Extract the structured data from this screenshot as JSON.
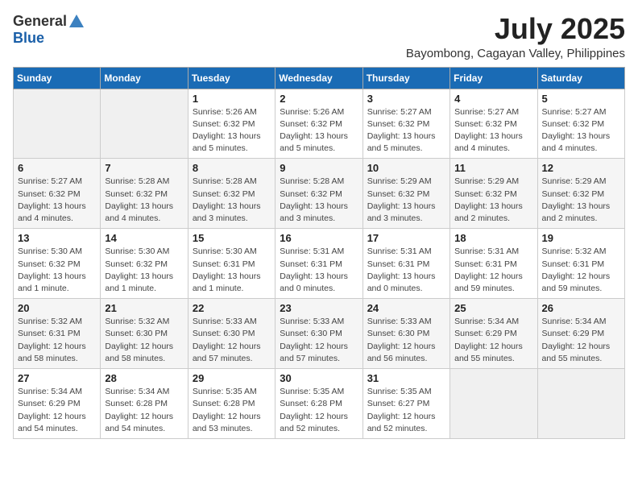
{
  "header": {
    "logo_general": "General",
    "logo_blue": "Blue",
    "month_title": "July 2025",
    "location": "Bayombong, Cagayan Valley, Philippines"
  },
  "days_of_week": [
    "Sunday",
    "Monday",
    "Tuesday",
    "Wednesday",
    "Thursday",
    "Friday",
    "Saturday"
  ],
  "weeks": [
    [
      {
        "day": "",
        "info": ""
      },
      {
        "day": "",
        "info": ""
      },
      {
        "day": "1",
        "info": "Sunrise: 5:26 AM\nSunset: 6:32 PM\nDaylight: 13 hours and 5 minutes."
      },
      {
        "day": "2",
        "info": "Sunrise: 5:26 AM\nSunset: 6:32 PM\nDaylight: 13 hours and 5 minutes."
      },
      {
        "day": "3",
        "info": "Sunrise: 5:27 AM\nSunset: 6:32 PM\nDaylight: 13 hours and 5 minutes."
      },
      {
        "day": "4",
        "info": "Sunrise: 5:27 AM\nSunset: 6:32 PM\nDaylight: 13 hours and 4 minutes."
      },
      {
        "day": "5",
        "info": "Sunrise: 5:27 AM\nSunset: 6:32 PM\nDaylight: 13 hours and 4 minutes."
      }
    ],
    [
      {
        "day": "6",
        "info": "Sunrise: 5:27 AM\nSunset: 6:32 PM\nDaylight: 13 hours and 4 minutes."
      },
      {
        "day": "7",
        "info": "Sunrise: 5:28 AM\nSunset: 6:32 PM\nDaylight: 13 hours and 4 minutes."
      },
      {
        "day": "8",
        "info": "Sunrise: 5:28 AM\nSunset: 6:32 PM\nDaylight: 13 hours and 3 minutes."
      },
      {
        "day": "9",
        "info": "Sunrise: 5:28 AM\nSunset: 6:32 PM\nDaylight: 13 hours and 3 minutes."
      },
      {
        "day": "10",
        "info": "Sunrise: 5:29 AM\nSunset: 6:32 PM\nDaylight: 13 hours and 3 minutes."
      },
      {
        "day": "11",
        "info": "Sunrise: 5:29 AM\nSunset: 6:32 PM\nDaylight: 13 hours and 2 minutes."
      },
      {
        "day": "12",
        "info": "Sunrise: 5:29 AM\nSunset: 6:32 PM\nDaylight: 13 hours and 2 minutes."
      }
    ],
    [
      {
        "day": "13",
        "info": "Sunrise: 5:30 AM\nSunset: 6:32 PM\nDaylight: 13 hours and 1 minute."
      },
      {
        "day": "14",
        "info": "Sunrise: 5:30 AM\nSunset: 6:32 PM\nDaylight: 13 hours and 1 minute."
      },
      {
        "day": "15",
        "info": "Sunrise: 5:30 AM\nSunset: 6:31 PM\nDaylight: 13 hours and 1 minute."
      },
      {
        "day": "16",
        "info": "Sunrise: 5:31 AM\nSunset: 6:31 PM\nDaylight: 13 hours and 0 minutes."
      },
      {
        "day": "17",
        "info": "Sunrise: 5:31 AM\nSunset: 6:31 PM\nDaylight: 13 hours and 0 minutes."
      },
      {
        "day": "18",
        "info": "Sunrise: 5:31 AM\nSunset: 6:31 PM\nDaylight: 12 hours and 59 minutes."
      },
      {
        "day": "19",
        "info": "Sunrise: 5:32 AM\nSunset: 6:31 PM\nDaylight: 12 hours and 59 minutes."
      }
    ],
    [
      {
        "day": "20",
        "info": "Sunrise: 5:32 AM\nSunset: 6:31 PM\nDaylight: 12 hours and 58 minutes."
      },
      {
        "day": "21",
        "info": "Sunrise: 5:32 AM\nSunset: 6:30 PM\nDaylight: 12 hours and 58 minutes."
      },
      {
        "day": "22",
        "info": "Sunrise: 5:33 AM\nSunset: 6:30 PM\nDaylight: 12 hours and 57 minutes."
      },
      {
        "day": "23",
        "info": "Sunrise: 5:33 AM\nSunset: 6:30 PM\nDaylight: 12 hours and 57 minutes."
      },
      {
        "day": "24",
        "info": "Sunrise: 5:33 AM\nSunset: 6:30 PM\nDaylight: 12 hours and 56 minutes."
      },
      {
        "day": "25",
        "info": "Sunrise: 5:34 AM\nSunset: 6:29 PM\nDaylight: 12 hours and 55 minutes."
      },
      {
        "day": "26",
        "info": "Sunrise: 5:34 AM\nSunset: 6:29 PM\nDaylight: 12 hours and 55 minutes."
      }
    ],
    [
      {
        "day": "27",
        "info": "Sunrise: 5:34 AM\nSunset: 6:29 PM\nDaylight: 12 hours and 54 minutes."
      },
      {
        "day": "28",
        "info": "Sunrise: 5:34 AM\nSunset: 6:28 PM\nDaylight: 12 hours and 54 minutes."
      },
      {
        "day": "29",
        "info": "Sunrise: 5:35 AM\nSunset: 6:28 PM\nDaylight: 12 hours and 53 minutes."
      },
      {
        "day": "30",
        "info": "Sunrise: 5:35 AM\nSunset: 6:28 PM\nDaylight: 12 hours and 52 minutes."
      },
      {
        "day": "31",
        "info": "Sunrise: 5:35 AM\nSunset: 6:27 PM\nDaylight: 12 hours and 52 minutes."
      },
      {
        "day": "",
        "info": ""
      },
      {
        "day": "",
        "info": ""
      }
    ]
  ]
}
